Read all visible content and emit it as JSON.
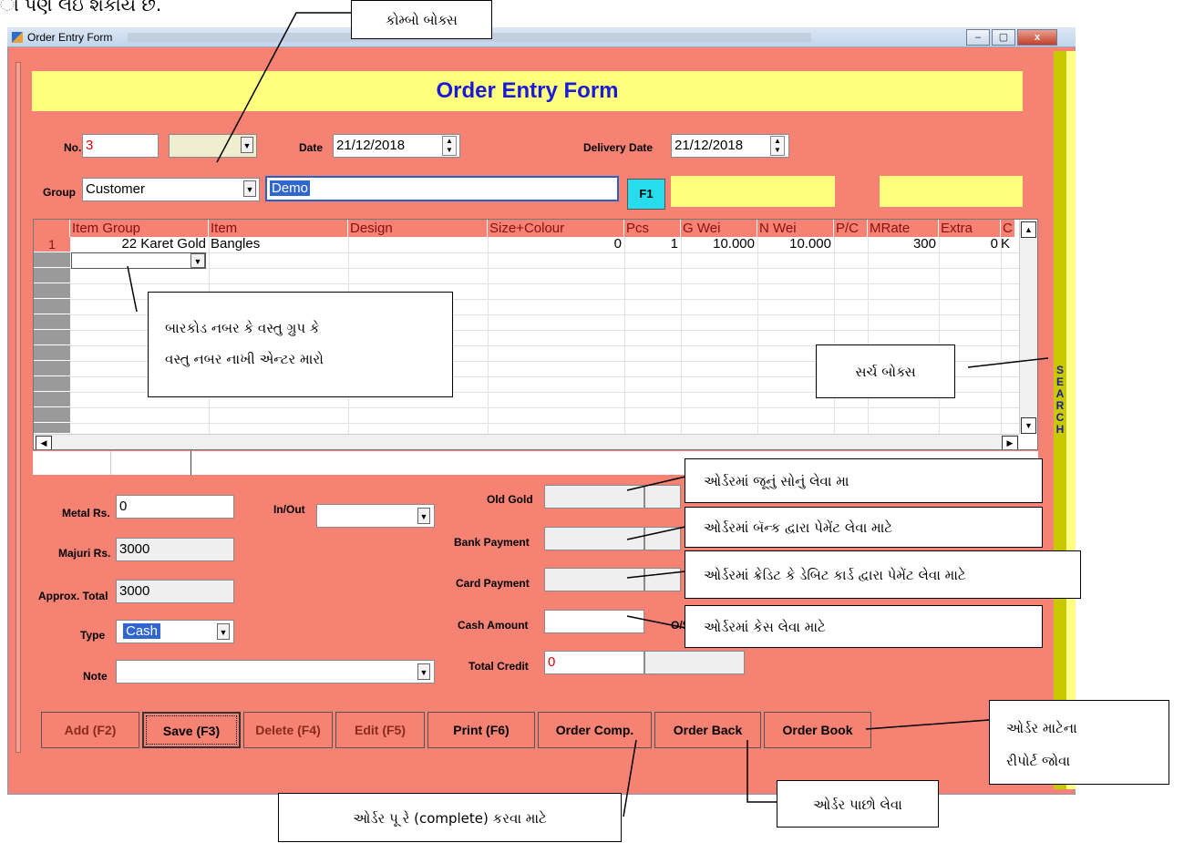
{
  "top_cut_text": "ા પણ લઇ શકાય છે.",
  "window": {
    "title": "Order Entry Form",
    "controls": [
      "–",
      "▢",
      "x"
    ]
  },
  "header": {
    "title": "Order Entry Form"
  },
  "form": {
    "no_label": "No.",
    "no_value": "3",
    "date_label": "Date",
    "date_value": "21/12/2018",
    "delivery_label": "Delivery Date",
    "delivery_value": "21/12/2018",
    "group_label": "Group",
    "group_value": "Customer",
    "name_value": "Demo",
    "f1_label": "F1"
  },
  "grid": {
    "columns": [
      "Item Group",
      "Item",
      "Design",
      "Size+Colour",
      "Pcs",
      "G Wei",
      "N Wei",
      "P/C",
      "MRate",
      "Extra",
      "C"
    ],
    "rows": [
      {
        "num": "1",
        "item_group": "22 Karet Gold",
        "item": "Bangles",
        "design": "",
        "size": "0",
        "pcs": "1",
        "gwei": "10.000",
        "nwei": "10.000",
        "pc": "",
        "mrate": "300",
        "extra": "0",
        "c": "K"
      }
    ]
  },
  "left_panel": {
    "metal_label": "Metal Rs.",
    "metal_value": "0",
    "majuri_label": "Majuri Rs.",
    "majuri_value": "3000",
    "approx_label": "Approx. Total",
    "approx_value": "3000",
    "type_label": "Type",
    "type_value": "Cash",
    "note_label": "Note",
    "inout_label": "In/Out"
  },
  "payments": {
    "old_gold": "Old Gold",
    "bank": "Bank Payment",
    "card": "Card Payment",
    "cash": "Cash Amount",
    "os_label": "O/S",
    "total_credit": "Total Credit",
    "total_credit_value": "0"
  },
  "search_label": "SEARCH",
  "buttons": [
    "Add (F2)",
    "Save (F3)",
    "Delete (F4)",
    "Edit (F5)",
    "Print (F6)",
    "Order Comp.",
    "Order Back",
    "Order Book"
  ],
  "callouts": {
    "combo": "કોમ્બો બોક્સ",
    "barcode_line1": "બારકોડ નબર કે વસ્તુ ગ્રુપ કે",
    "barcode_line2": "વસ્તુ નબર નાખી એન્ટર મારો",
    "search": "સર્ચ બોક્સ",
    "old_gold": "ઓર્ડરમાં જૂનું સોનું લેવા મા",
    "bank": "ઓર્ડરમાં બૅન્ક દ્વારા પેમેંટ લેવા માટે",
    "card": "ઓર્ડરમાં ક્રેડિટ કે ડેબિટ કાર્ડ દ્વારા પેમેંટ લેવા માટે",
    "cash": "ઓર્ડરમાં કેસ લેવા માટે",
    "report_line1": "ઓર્ડર માટેના",
    "report_line2": "રીપોર્ટ જોવા",
    "complete": "ઓર્ડર પૂ રે (complete) કરવા માટે",
    "back": "ઓર્ડર પાછો લેવા"
  }
}
